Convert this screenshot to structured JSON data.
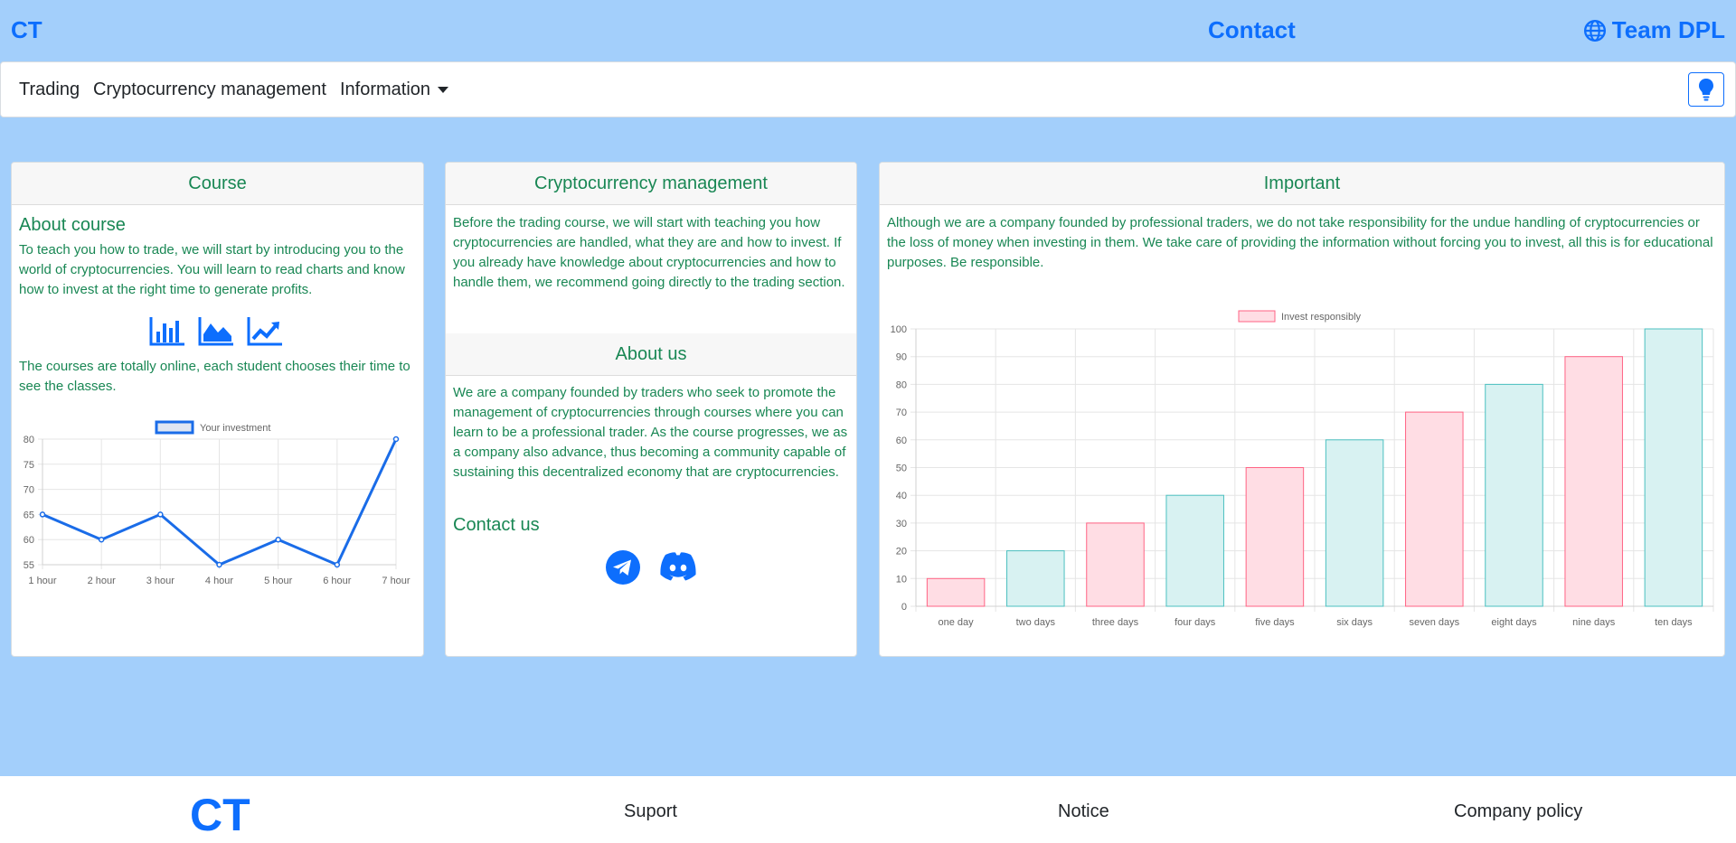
{
  "header": {
    "brand": "CT",
    "contact": "Contact",
    "team": "Team DPL",
    "team_icon": "globe-icon"
  },
  "nav": {
    "items": [
      "Trading",
      "Cryptocurrency management",
      "Information"
    ],
    "theme_button_icon": "lightbulb-icon"
  },
  "card_course": {
    "header": "Course",
    "about_title": "About course",
    "about_text": "To teach you how to trade, we will start by introducing you to the world of cryptocurrencies. You will learn to read charts and know how to invest at the right time to generate profits.",
    "icons": [
      "bar-chart-icon",
      "area-chart-icon",
      "line-chart-icon"
    ],
    "text2": "The courses are totally online, each student chooses their time to see the classes."
  },
  "card_management": {
    "header": "Cryptocurrency management",
    "text": "Before the trading course, we will start with teaching you how cryptocurrencies are handled, what they are and how to invest. If you already have knowledge about cryptocurrencies and how to handle them, we recommend going directly to the trading section.",
    "about_header": "About us",
    "about_text": "We are a company founded by traders who seek to promote the management of cryptocurrencies through courses where you can learn to be a professional trader. As the course progresses, we as a company also advance, thus becoming a community capable of sustaining this decentralized economy that are cryptocurrencies.",
    "contact_title": "Contact us",
    "social_icons": [
      "telegram-icon",
      "discord-icon"
    ]
  },
  "card_important": {
    "header": "Important",
    "text": "Although we are a company founded by professional traders, we do not take responsibility for the undue handling of cryptocurrencies or the loss of money when investing in them. We take care of providing the information without forcing you to invest, all this is for educational purposes. Be responsible."
  },
  "chart_data": [
    {
      "type": "line",
      "categories": [
        "1 hour",
        "2 hour",
        "3 hour",
        "4 hour",
        "5 hour",
        "6 hour",
        "7 hour"
      ],
      "series": [
        {
          "name": "Your investment",
          "values": [
            65,
            60,
            65,
            55,
            60,
            55,
            80
          ]
        }
      ],
      "ylim": [
        55,
        80
      ],
      "yticks": [
        55,
        60,
        65,
        70,
        75,
        80
      ],
      "legend": "top-center",
      "grid": true,
      "colors": {
        "line": "#1a6ce8"
      }
    },
    {
      "type": "bar",
      "categories": [
        "one day",
        "two days",
        "three days",
        "four days",
        "five days",
        "six days",
        "seven days",
        "eight days",
        "nine days",
        "ten days"
      ],
      "series": [
        {
          "name": "Invest responsibly",
          "values": [
            10,
            20,
            30,
            40,
            50,
            60,
            70,
            80,
            90,
            100
          ]
        }
      ],
      "ylim": [
        0,
        100
      ],
      "yticks": [
        0,
        10,
        20,
        30,
        40,
        50,
        60,
        70,
        80,
        90,
        100
      ],
      "legend": "top-center",
      "grid": true,
      "colors": {
        "pink_fill": "#ffdde4",
        "pink_stroke": "#ff6384",
        "teal_fill": "#d8f2f2",
        "teal_stroke": "#4bc0c0"
      }
    }
  ],
  "footer": {
    "logo": "CT",
    "links": [
      "Suport",
      "Notice",
      "Company policy"
    ]
  }
}
